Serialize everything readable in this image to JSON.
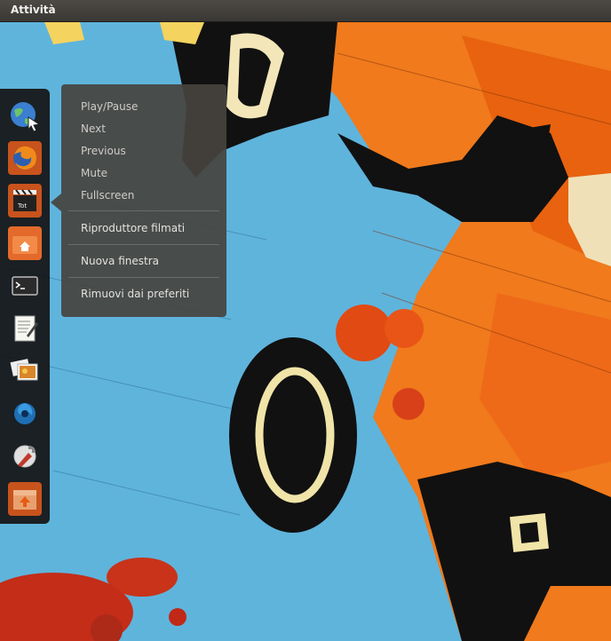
{
  "topbar": {
    "activities_label": "Attività"
  },
  "dock": {
    "items": [
      {
        "name": "browser-globe-icon"
      },
      {
        "name": "firefox-icon"
      },
      {
        "name": "video-player-icon"
      },
      {
        "name": "home-folder-icon"
      },
      {
        "name": "terminal-icon"
      },
      {
        "name": "text-editor-icon"
      },
      {
        "name": "image-viewer-icon"
      },
      {
        "name": "shotwell-icon"
      },
      {
        "name": "system-settings-icon"
      },
      {
        "name": "software-updater-icon"
      }
    ]
  },
  "menu": {
    "quicklist": [
      "Play/Pause",
      "Next",
      "Previous",
      "Mute",
      "Fullscreen"
    ],
    "app_name": "Riproduttore filmati",
    "new_window": "Nuova finestra",
    "remove_favorite": "Rimuovi dai preferiti"
  }
}
